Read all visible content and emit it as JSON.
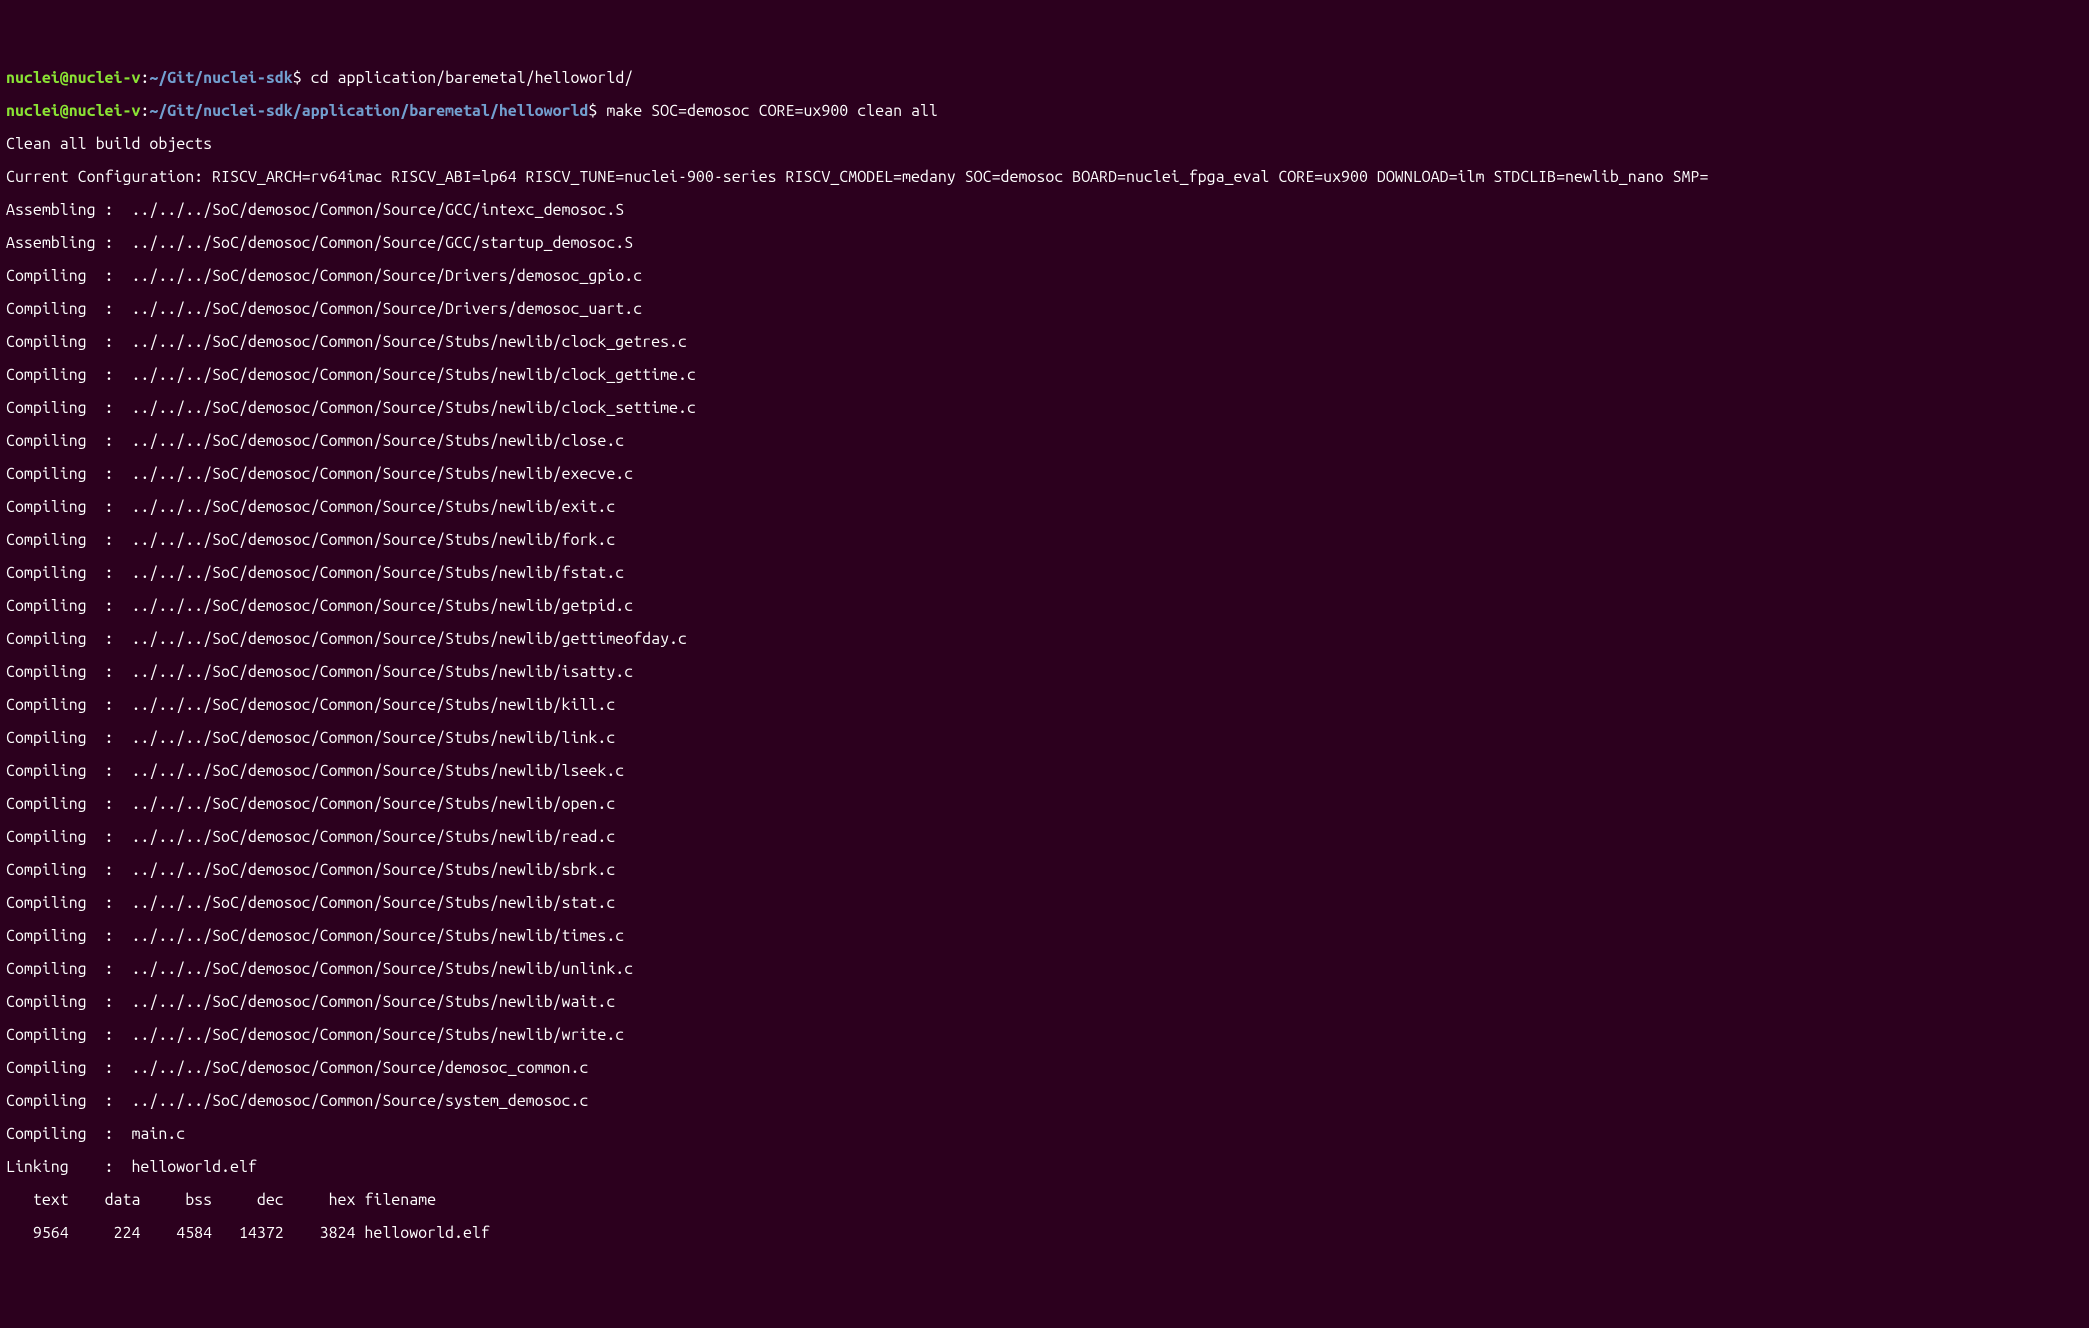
{
  "prompt1": {
    "user": "nuclei@nuclei-v",
    "colon": ":",
    "path": "~/Git/nuclei-sdk",
    "dollar": "$ ",
    "cmd": "cd application/baremetal/helloworld/"
  },
  "prompt2": {
    "user": "nuclei@nuclei-v",
    "colon": ":",
    "path": "~/Git/nuclei-sdk/application/baremetal/helloworld",
    "dollar": "$ ",
    "cmd": "make SOC=demosoc CORE=ux900 clean all"
  },
  "out": {
    "l0": "Clean all build objects",
    "l1": "Current Configuration: RISCV_ARCH=rv64imac RISCV_ABI=lp64 RISCV_TUNE=nuclei-900-series RISCV_CMODEL=medany SOC=demosoc BOARD=nuclei_fpga_eval CORE=ux900 DOWNLOAD=ilm STDCLIB=newlib_nano SMP=",
    "l2": "Assembling :  ../../../SoC/demosoc/Common/Source/GCC/intexc_demosoc.S",
    "l3": "Assembling :  ../../../SoC/demosoc/Common/Source/GCC/startup_demosoc.S",
    "l4": "Compiling  :  ../../../SoC/demosoc/Common/Source/Drivers/demosoc_gpio.c",
    "l5": "Compiling  :  ../../../SoC/demosoc/Common/Source/Drivers/demosoc_uart.c",
    "l6": "Compiling  :  ../../../SoC/demosoc/Common/Source/Stubs/newlib/clock_getres.c",
    "l7": "Compiling  :  ../../../SoC/demosoc/Common/Source/Stubs/newlib/clock_gettime.c",
    "l8": "Compiling  :  ../../../SoC/demosoc/Common/Source/Stubs/newlib/clock_settime.c",
    "l9": "Compiling  :  ../../../SoC/demosoc/Common/Source/Stubs/newlib/close.c",
    "l10": "Compiling  :  ../../../SoC/demosoc/Common/Source/Stubs/newlib/execve.c",
    "l11": "Compiling  :  ../../../SoC/demosoc/Common/Source/Stubs/newlib/exit.c",
    "l12": "Compiling  :  ../../../SoC/demosoc/Common/Source/Stubs/newlib/fork.c",
    "l13": "Compiling  :  ../../../SoC/demosoc/Common/Source/Stubs/newlib/fstat.c",
    "l14": "Compiling  :  ../../../SoC/demosoc/Common/Source/Stubs/newlib/getpid.c",
    "l15": "Compiling  :  ../../../SoC/demosoc/Common/Source/Stubs/newlib/gettimeofday.c",
    "l16": "Compiling  :  ../../../SoC/demosoc/Common/Source/Stubs/newlib/isatty.c",
    "l17": "Compiling  :  ../../../SoC/demosoc/Common/Source/Stubs/newlib/kill.c",
    "l18": "Compiling  :  ../../../SoC/demosoc/Common/Source/Stubs/newlib/link.c",
    "l19": "Compiling  :  ../../../SoC/demosoc/Common/Source/Stubs/newlib/lseek.c",
    "l20": "Compiling  :  ../../../SoC/demosoc/Common/Source/Stubs/newlib/open.c",
    "l21": "Compiling  :  ../../../SoC/demosoc/Common/Source/Stubs/newlib/read.c",
    "l22": "Compiling  :  ../../../SoC/demosoc/Common/Source/Stubs/newlib/sbrk.c",
    "l23": "Compiling  :  ../../../SoC/demosoc/Common/Source/Stubs/newlib/stat.c",
    "l24": "Compiling  :  ../../../SoC/demosoc/Common/Source/Stubs/newlib/times.c",
    "l25": "Compiling  :  ../../../SoC/demosoc/Common/Source/Stubs/newlib/unlink.c",
    "l26": "Compiling  :  ../../../SoC/demosoc/Common/Source/Stubs/newlib/wait.c",
    "l27": "Compiling  :  ../../../SoC/demosoc/Common/Source/Stubs/newlib/write.c",
    "l28": "Compiling  :  ../../../SoC/demosoc/Common/Source/demosoc_common.c",
    "l29": "Compiling  :  ../../../SoC/demosoc/Common/Source/system_demosoc.c",
    "l30": "Compiling  :  main.c",
    "l31": "Linking    :  helloworld.elf",
    "l32": "   text\t   data\t    bss\t    dec\t    hex\tfilename",
    "l33": "   9564\t    224\t   4584\t  14372\t   3824\thelloworld.elf"
  }
}
